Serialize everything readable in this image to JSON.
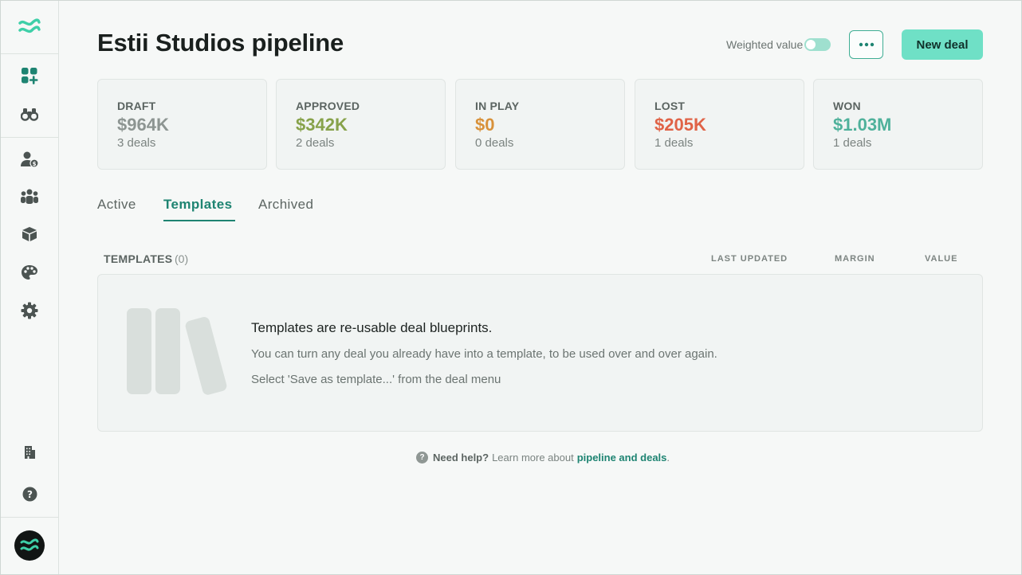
{
  "header": {
    "title": "Estii Studios pipeline",
    "weighted_label": "Weighted value",
    "weighted_on": false,
    "more_label": "•••",
    "new_deal_label": "New deal"
  },
  "stats": [
    {
      "label": "DRAFT",
      "value": "$964K",
      "count": "3 deals",
      "color": "#8d9592"
    },
    {
      "label": "APPROVED",
      "value": "$342K",
      "count": "2 deals",
      "color": "#87a24a"
    },
    {
      "label": "IN PLAY",
      "value": "$0",
      "count": "0 deals",
      "color": "#d8913a"
    },
    {
      "label": "LOST",
      "value": "$205K",
      "count": "1 deals",
      "color": "#e06347"
    },
    {
      "label": "WON",
      "value": "$1.03M",
      "count": "1 deals",
      "color": "#4fb19b"
    }
  ],
  "tabs": [
    {
      "label": "Active",
      "active": false
    },
    {
      "label": "Templates",
      "active": true
    },
    {
      "label": "Archived",
      "active": false
    }
  ],
  "table": {
    "title": "TEMPLATES",
    "count": "(0)",
    "columns": [
      "LAST UPDATED",
      "MARGIN",
      "VALUE"
    ]
  },
  "empty_state": {
    "heading": "Templates are re-usable deal blueprints.",
    "line1": "You can turn any deal you already have into a template, to be used over and over again.",
    "line2": "Select 'Save as template...' from the deal menu"
  },
  "help": {
    "icon": "?",
    "bold": "Need help?",
    "text": "Learn more about",
    "link": "pipeline and deals",
    "period": "."
  },
  "sidebar": {
    "icons": [
      "pipeline-icon",
      "binoculars-icon",
      "user-money-icon",
      "team-icon",
      "box-icon",
      "palette-icon",
      "gear-icon",
      "building-icon",
      "help-icon"
    ]
  },
  "colors": {
    "accent": "#1e8472",
    "button": "#6fe0c6"
  }
}
